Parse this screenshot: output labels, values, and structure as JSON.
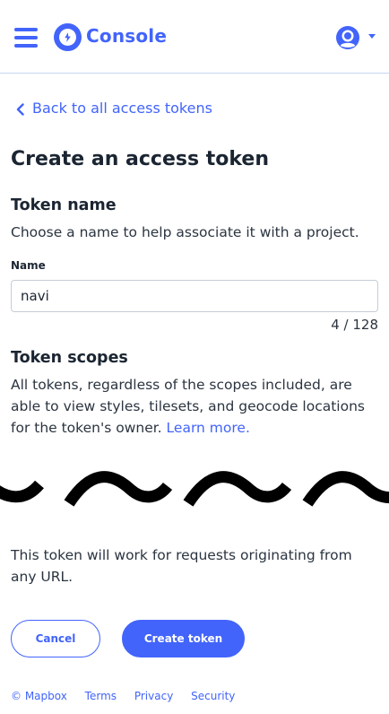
{
  "header": {
    "brand": "Console",
    "accent_color": "#4264fb",
    "menu_icon": "hamburger-menu-icon",
    "logo_icon": "mapbox-logo-icon",
    "account_icon": "user-avatar-icon"
  },
  "back_link": {
    "label": "Back to all access tokens",
    "icon": "chevron-left-icon"
  },
  "page_title": "Create an access token",
  "token_name": {
    "heading": "Token name",
    "description": "Choose a name to help associate it with a project.",
    "field_label": "Name",
    "value": "navi",
    "counter": "4 / 128"
  },
  "token_scopes": {
    "heading": "Token scopes",
    "description": "All tokens, regardless of the scopes included, are able to view styles, tilesets, and geocode locations for the token's owner.",
    "link": "Learn more."
  },
  "url_restriction_note": "This token will work for requests originating from any URL.",
  "actions": {
    "cancel": "Cancel",
    "create": "Create token"
  },
  "footer": {
    "copyright": "© Mapbox",
    "links": [
      "Terms",
      "Privacy",
      "Security"
    ]
  }
}
